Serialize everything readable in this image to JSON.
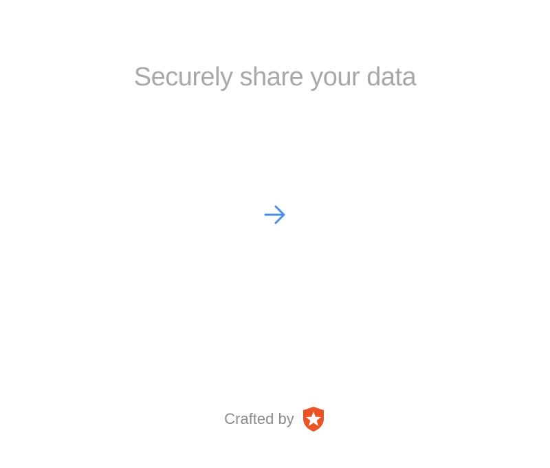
{
  "title": "Securely share your data",
  "next": {
    "icon": "arrow-right-icon",
    "color": "#4a90e2"
  },
  "footer": {
    "text": "Crafted by",
    "logo": {
      "icon": "shield-star-logo",
      "color": "#eb5424"
    }
  }
}
